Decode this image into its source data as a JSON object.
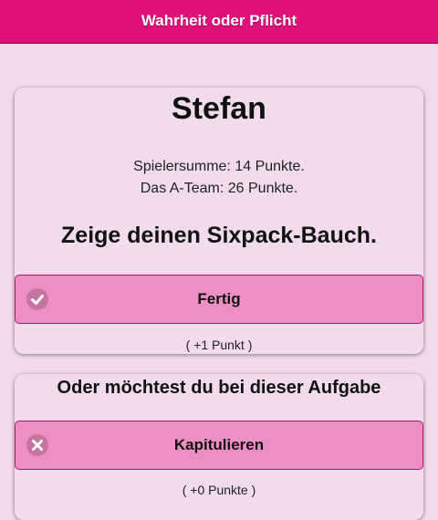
{
  "header": {
    "title": "Wahrheit oder Pflicht"
  },
  "turn_card": {
    "player_name": "Stefan",
    "player_score": "Spielersumme: 14 Punkte.",
    "team_score": "Das A-Team: 26 Punkte.",
    "task": "Zeige deinen Sixpack-Bauch.",
    "done_button": {
      "label": "Fertig",
      "icon": "check-icon"
    },
    "done_points": "( +1 Punkt )"
  },
  "surrender_card": {
    "question": "Oder möchtest du bei dieser Aufgabe",
    "surrender_button": {
      "label": "Kapitulieren",
      "icon": "close-icon"
    },
    "surrender_points": "( +0 Punkte )"
  },
  "colors": {
    "header_bg": "#e0107a",
    "page_bg": "#f2dbec",
    "button_bg": "#ee8fc4",
    "button_border": "#b0156a"
  }
}
